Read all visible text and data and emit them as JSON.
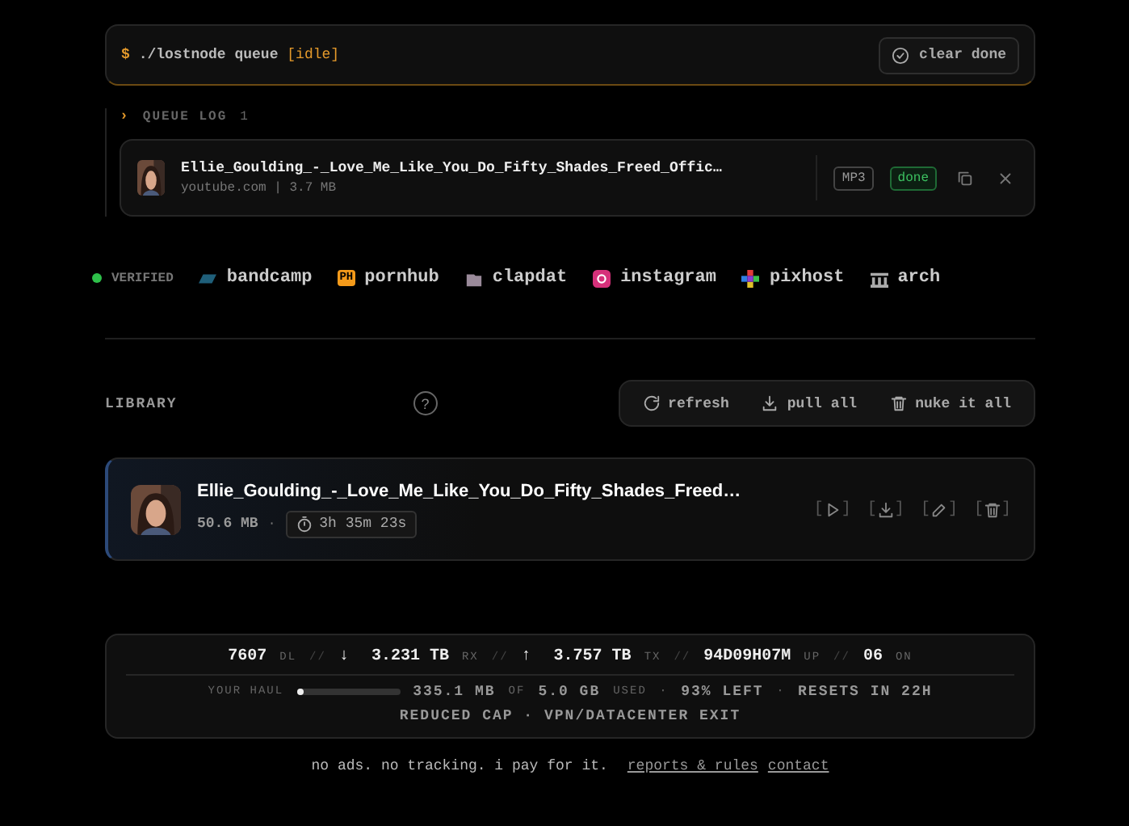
{
  "queue_bar": {
    "prompt": "$",
    "command": "./lostnode queue",
    "status": "[idle]",
    "clear_button": "clear done"
  },
  "queue_log": {
    "caret": "›",
    "title": "QUEUE LOG",
    "count": "1",
    "items": [
      {
        "title": "Ellie_Goulding_-_Love_Me_Like_You_Do_Fifty_Shades_Freed_Offic…",
        "source": "youtube.com | 3.7 MB",
        "format": "MP3",
        "status": "done",
        "thumbnail": {
          "kind": "picture"
        }
      }
    ]
  },
  "sources": {
    "verified_label": "VERIFIED",
    "items": [
      {
        "name": "bandcamp",
        "kind": "bandcamp"
      },
      {
        "name": "pornhub",
        "kind": "pornhub",
        "badge": "PH"
      },
      {
        "name": "clapdat",
        "kind": "clapdat"
      },
      {
        "name": "instagram",
        "kind": "instagram"
      },
      {
        "name": "pixhost",
        "kind": "pixhost"
      },
      {
        "name": "arch",
        "kind": "archive"
      }
    ]
  },
  "library": {
    "title": "LIBRARY",
    "help": "?",
    "actions": [
      {
        "label": "refresh",
        "kind": "refresh"
      },
      {
        "label": "pull all",
        "kind": "download"
      },
      {
        "label": "nuke it all",
        "kind": "trash"
      }
    ],
    "items": [
      {
        "title": "Ellie_Goulding_-_Love_Me_Like_You_Do_Fifty_Shades_Freed…",
        "size": "50.6 MB",
        "separator": "·",
        "duration": "3h 35m 23s",
        "thumbnail": {
          "kind": "picture"
        },
        "bracket_open": "[",
        "bracket_close": "]",
        "actions": [
          {
            "kind": "play"
          },
          {
            "kind": "download"
          },
          {
            "kind": "edit"
          },
          {
            "kind": "delete"
          }
        ]
      }
    ]
  },
  "stats": {
    "counters": [
      {
        "value": "7607",
        "unit": "DL"
      },
      {
        "arrow": "↓",
        "value": "3.231 TB",
        "unit": "RX"
      },
      {
        "arrow": "↑",
        "value": "3.757 TB",
        "unit": "TX"
      },
      {
        "value": "94D09H07M",
        "unit": "UP"
      },
      {
        "value": "06",
        "unit": "ON"
      }
    ],
    "separator": "//",
    "haul": {
      "label": "YOUR HAUL",
      "level": 0.07,
      "used": "335.1 MB",
      "of": "OF",
      "total": "5.0 GB",
      "used_label": "USED",
      "left": "93% LEFT",
      "resets": "RESETS IN 22H",
      "dot": "·"
    },
    "note": "REDUCED CAP · VPN/DATACENTER EXIT"
  },
  "footer": {
    "text": "no ads. no tracking. i pay for it.",
    "links": [
      "reports & rules",
      "contact"
    ]
  }
}
